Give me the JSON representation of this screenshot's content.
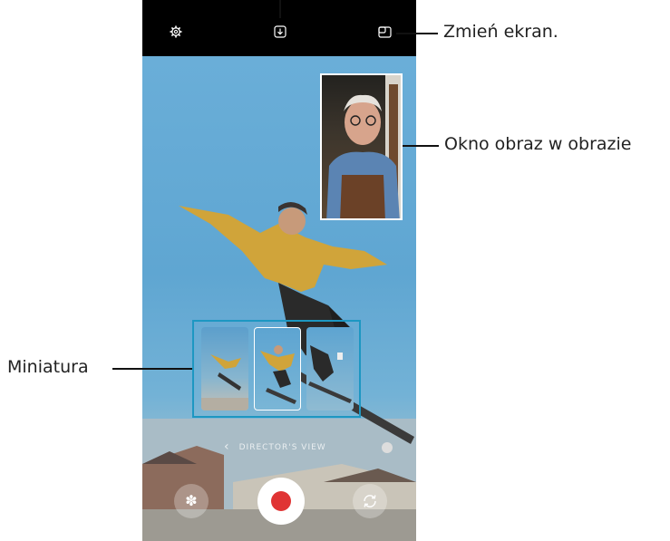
{
  "annotations": {
    "change_screen": "Zmień ekran.",
    "pip_window": "Okno obraz w obrazie",
    "thumbnail": "Miniatura"
  },
  "screen": {
    "director_view_label": "DIRECTOR'S VIEW",
    "icons": {
      "settings": "gear-icon",
      "download": "download-icon",
      "change_screen": "split-screen-icon",
      "effects": "flower-icon",
      "switch_camera": "rotate-camera-icon"
    }
  },
  "colors": {
    "record": "#e03434",
    "thumbnail_frame": "#1d97c2",
    "top_bar": "#000000"
  }
}
